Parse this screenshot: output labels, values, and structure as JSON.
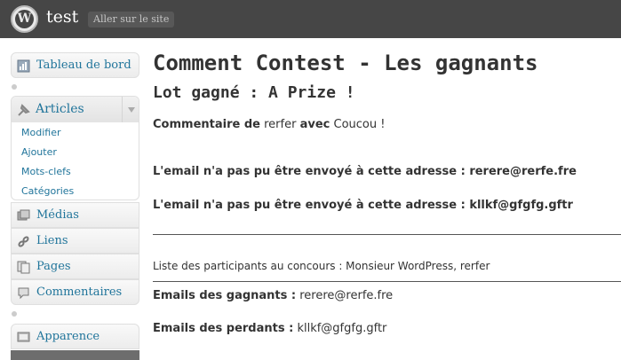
{
  "header": {
    "site_name": "test",
    "visit_site_label": "Aller sur le site",
    "logo_letter": "W"
  },
  "sidebar": {
    "dashboard_label": "Tableau de bord",
    "articles_label": "Articles",
    "submenu": [
      "Modifier",
      "Ajouter",
      "Mots-clefs",
      "Catégories"
    ],
    "items": [
      "Médias",
      "Liens",
      "Pages",
      "Commentaires",
      "Apparence"
    ]
  },
  "main": {
    "title": "Comment Contest - Les gagnants",
    "prize_title": "Lot gagné : A Prize !",
    "comment_prefix": "Commentaire de",
    "comment_author": "rerfer",
    "comment_with": "avec",
    "comment_text": "Coucou !",
    "email_error_1": "L'email n'a pas pu être envoyé à cette adresse : rerere@rerfe.fre",
    "email_error_2": "L'email n'a pas pu être envoyé à cette adresse : kllkf@gfgfg.gftr",
    "participants": "Liste des participants au concours : Monsieur WordPress, rerfer",
    "winners_label": "Emails des gagnants :",
    "winners_value": "rerere@rerfe.fre",
    "losers_label": "Emails des perdants :",
    "losers_value": "kllkf@gfgfg.gftr"
  }
}
